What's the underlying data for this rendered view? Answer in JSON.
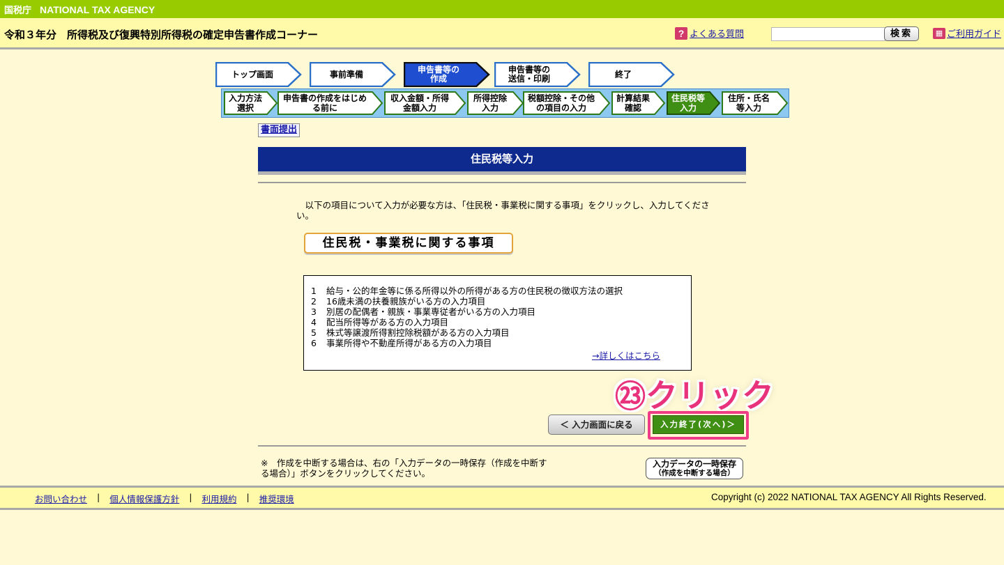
{
  "header": {
    "agency_jp": "国税庁",
    "agency_en": "NATIONAL TAX AGENCY",
    "title": "令和３年分　所得税及び復興特別所得税の確定申告書作成コーナー",
    "faq_icon": "?",
    "faq_label": "よくある質問",
    "search_placeholder": "",
    "search_button": "検索",
    "guide_label": "ご利用ガイド"
  },
  "main_steps": [
    {
      "line1": "トップ画面",
      "line2": "",
      "active": false
    },
    {
      "line1": "事前準備",
      "line2": "",
      "active": false
    },
    {
      "line1": "申告書等の",
      "line2": "作成",
      "active": true
    },
    {
      "line1": "申告書等の",
      "line2": "送信・印刷",
      "active": false
    },
    {
      "line1": "終了",
      "line2": "",
      "active": false
    }
  ],
  "sub_steps": [
    {
      "line1": "入力方法",
      "line2": "選択",
      "active": false
    },
    {
      "line1": "申告書の作成をはじめ",
      "line2": "る前に",
      "active": false
    },
    {
      "line1": "収入金額・所得",
      "line2": "金額入力",
      "active": false
    },
    {
      "line1": "所得控除",
      "line2": "入力",
      "active": false
    },
    {
      "line1": "税額控除・その他",
      "line2": "の項目の入力",
      "active": false
    },
    {
      "line1": "計算結果",
      "line2": "確認",
      "active": false
    },
    {
      "line1": "住民税等",
      "line2": "入力",
      "active": true
    },
    {
      "line1": "住所・氏名",
      "line2": "等入力",
      "active": false
    }
  ],
  "paper_submit": "書面提出",
  "section_title": "住民税等入力",
  "intro_text": "　以下の項目について入力が必要な方は、「住民税・事業税に関する事項」をクリックし、入力してください。",
  "resident_tax_button": "住民税・事業税に関する事項",
  "info_items": [
    {
      "num": "1",
      "text": "給与・公的年金等に係る所得以外の所得がある方の住民税の徴収方法の選択"
    },
    {
      "num": "2",
      "text": "16歳未満の扶養親族がいる方の入力項目"
    },
    {
      "num": "3",
      "text": "別居の配偶者・親族・事業専従者がいる方の入力項目"
    },
    {
      "num": "4",
      "text": "配当所得等がある方の入力項目"
    },
    {
      "num": "5",
      "text": "株式等譲渡所得割控除税額がある方の入力項目"
    },
    {
      "num": "6",
      "text": "事業所得や不動産所得がある方の入力項目"
    }
  ],
  "details_link": "→詳しくはこちら",
  "callout": {
    "number": "㉓",
    "text": "クリック"
  },
  "back_button": "＜ 入力画面に戻る",
  "finish_button": "入力終了(次へ)＞",
  "note_text": "※　作成を中断する場合は、右の「入力データの一時保存（作成を中断する場合）」ボタンをクリックしてください。",
  "save_button": {
    "line1": "入力データの一時保存",
    "line2": "（作成を中断する場合）"
  },
  "footer": {
    "links": [
      "お問い合わせ",
      "個人情報保護方針",
      "利用規約",
      "推奨環境"
    ],
    "separator": "|",
    "copyright": "Copyright (c) 2022 NATIONAL TAX AGENCY All Rights Reserved."
  },
  "colors": {
    "top_bar": "#99cc00",
    "section_header": "#0f2a8e",
    "active_main_step": "#1f4fd0",
    "active_sub_step": "#3f8f14",
    "callout": "#e8337c"
  }
}
